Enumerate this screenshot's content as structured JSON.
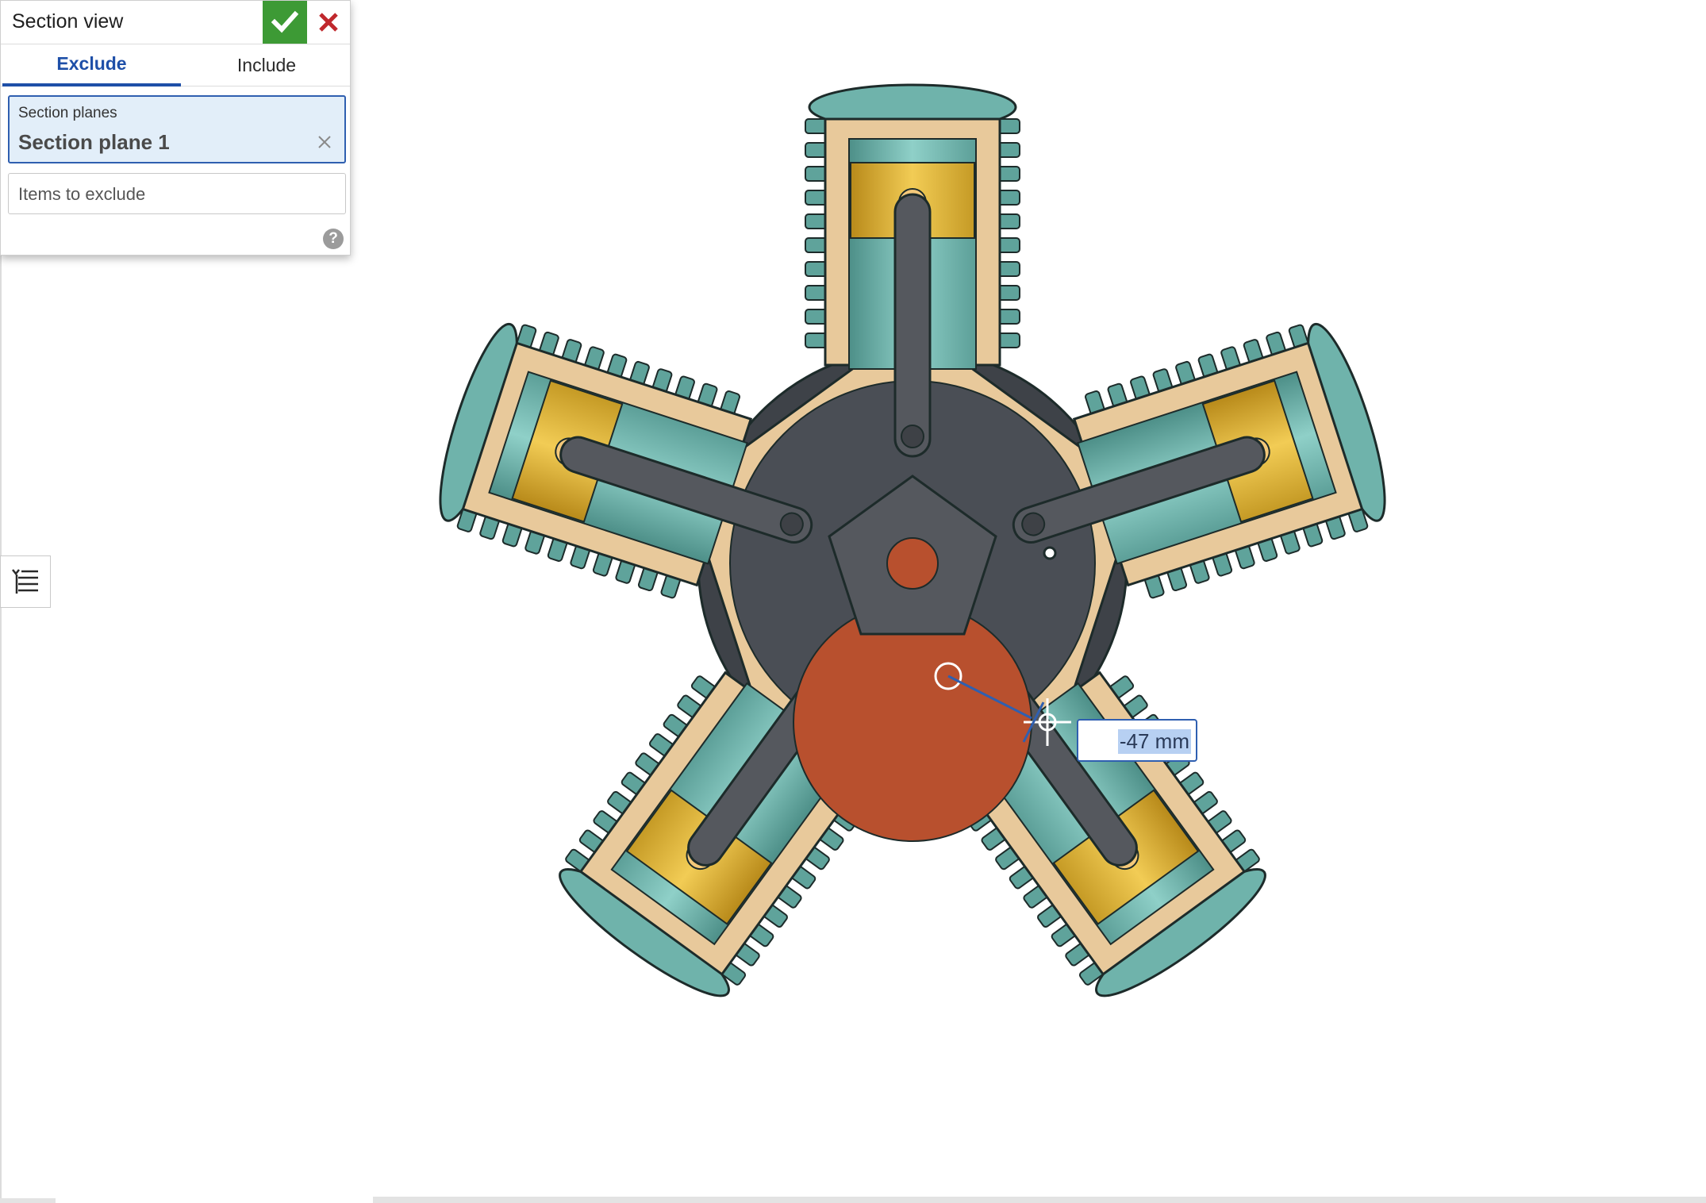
{
  "dialog": {
    "title": "Section view",
    "tabs": [
      {
        "label": "Exclude",
        "active": true
      },
      {
        "label": "Include",
        "active": false
      }
    ],
    "section_planes": {
      "label": "Section planes",
      "items": [
        "Section plane 1"
      ]
    },
    "items_to_exclude": {
      "placeholder": "Items to exclude"
    },
    "help_glyph": "?",
    "accept_icon": "check-icon",
    "cancel_icon": "close-icon"
  },
  "dimension": {
    "value": "-47 mm"
  },
  "colors": {
    "accept_green": "#3d9a35",
    "cancel_red": "#c0282d",
    "accent_blue": "#1e4fa8",
    "cylinder_teal": "#6fb3ab",
    "section_tan": "#e8c99b",
    "piston_gold": "#d4a72c",
    "rod_gray": "#55585e",
    "crank_red": "#b8502e"
  },
  "model": {
    "cylinder_count": 5
  }
}
